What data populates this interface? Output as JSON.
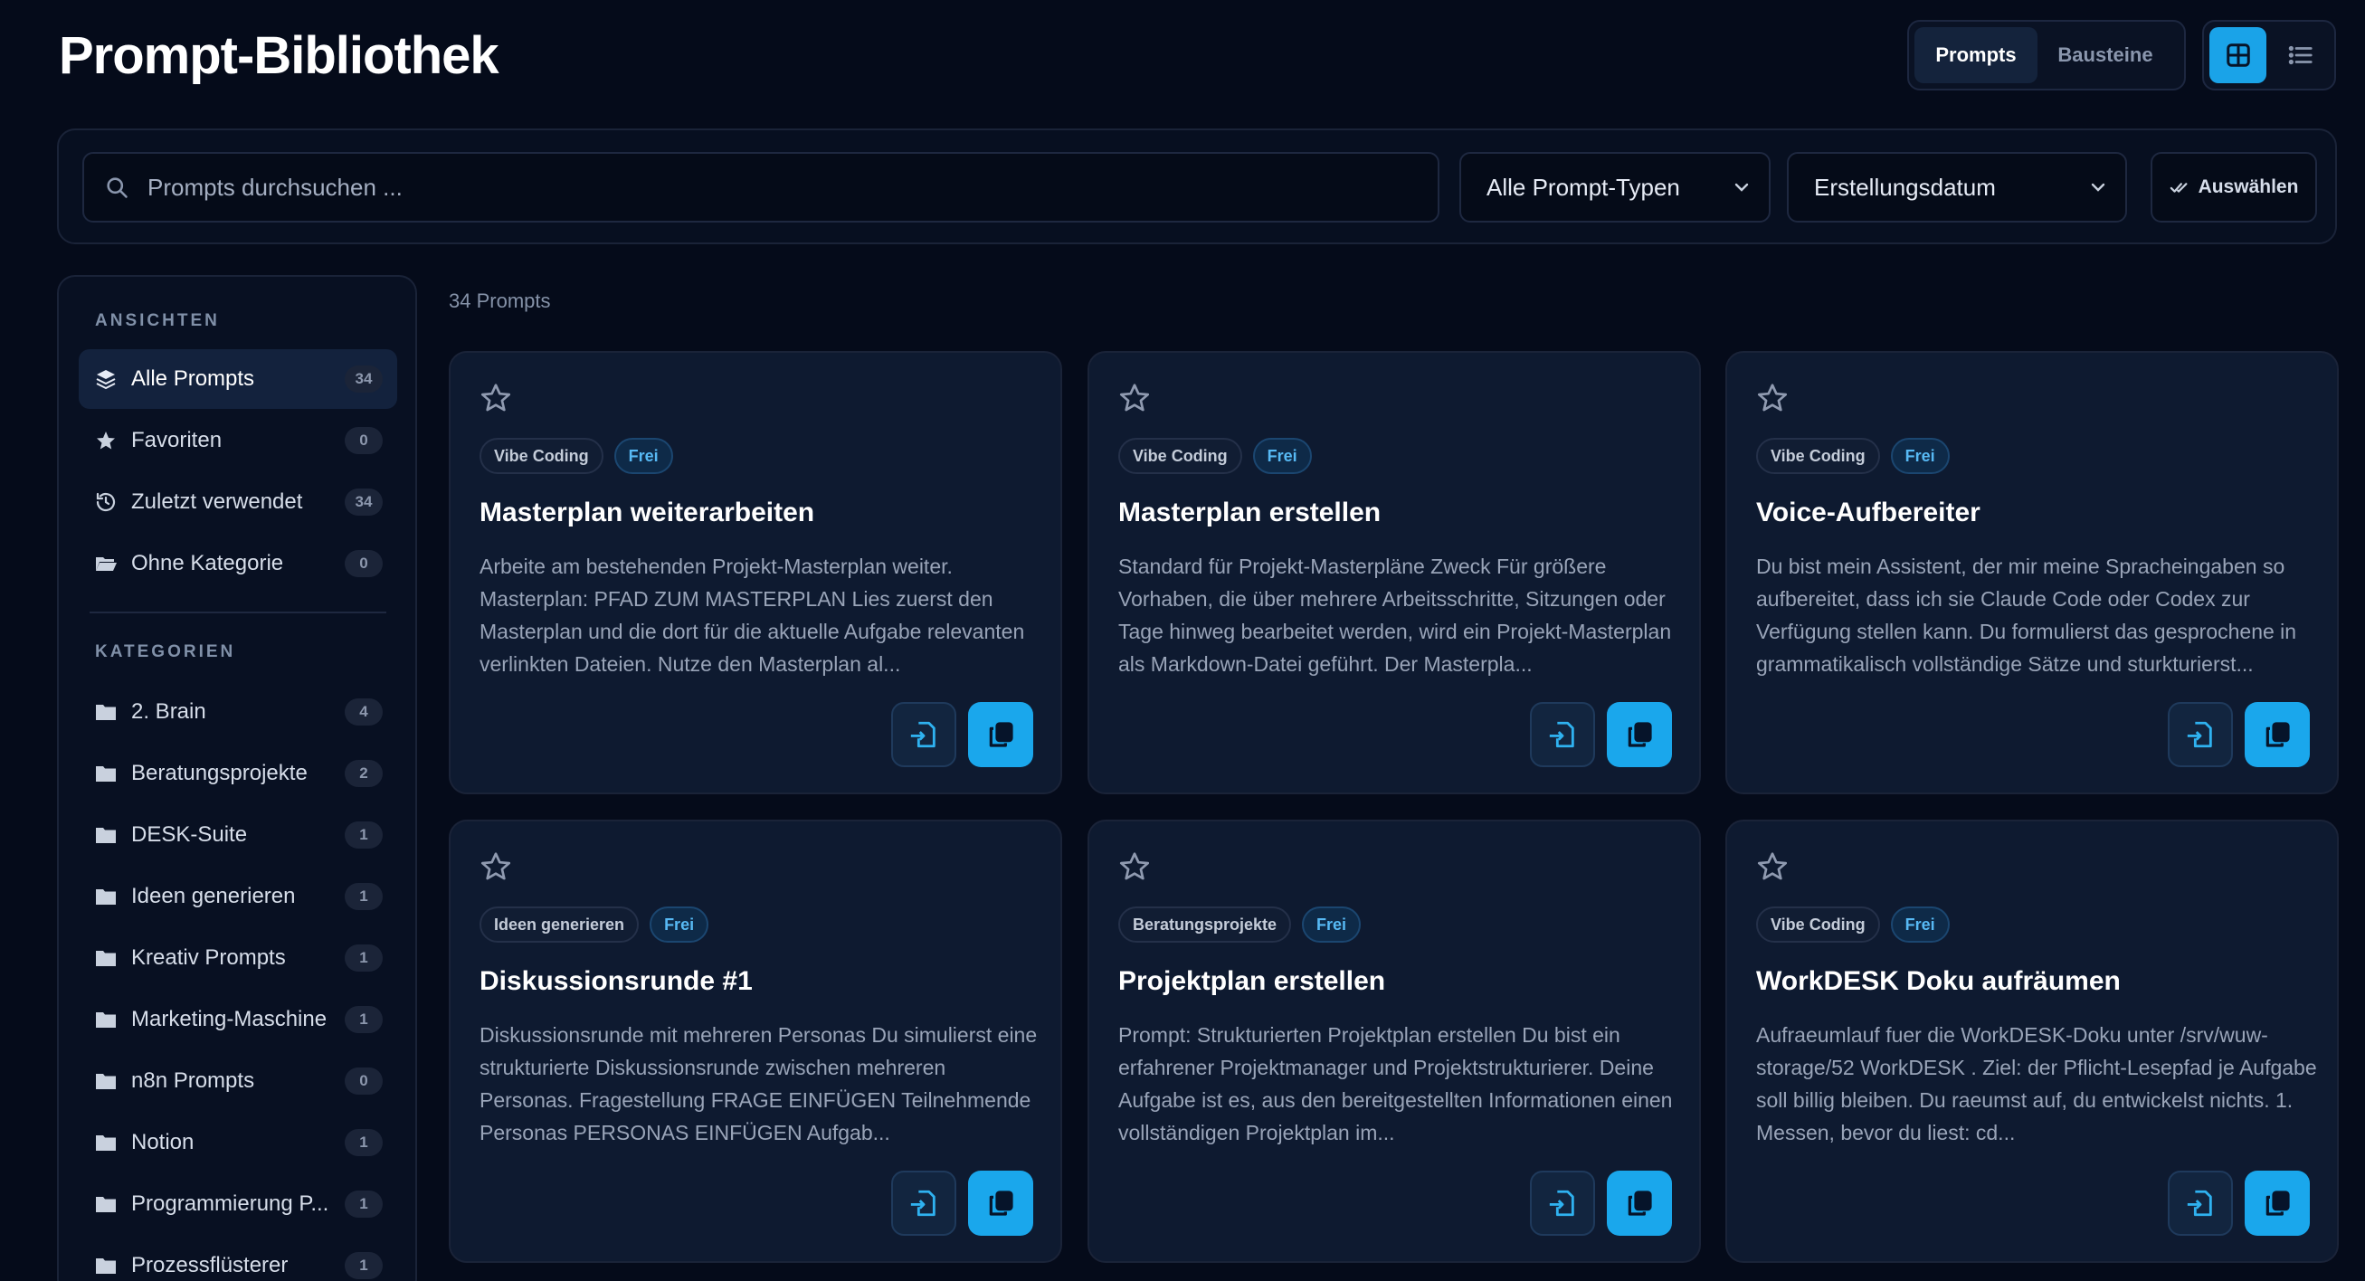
{
  "header": {
    "title": "Prompt-Bibliothek",
    "modes": [
      "Prompts",
      "Bausteine"
    ],
    "active_mode": "Prompts",
    "views": [
      "grid-view",
      "list-view"
    ],
    "active_view": "grid-view"
  },
  "filters": {
    "search_placeholder": "Prompts durchsuchen ...",
    "type_select": "Alle Prompt-Typen",
    "sort_select": "Erstellungsdatum",
    "select_button": "Auswählen"
  },
  "sidebar": {
    "views_heading": "ANSICHTEN",
    "views": [
      {
        "label": "Alle Prompts",
        "count": "34",
        "icon": "layers-icon"
      },
      {
        "label": "Favoriten",
        "count": "0",
        "icon": "star-icon"
      },
      {
        "label": "Zuletzt verwendet",
        "count": "34",
        "icon": "history-icon"
      },
      {
        "label": "Ohne Kategorie",
        "count": "0",
        "icon": "folder-open-icon"
      }
    ],
    "categories_heading": "KATEGORIEN",
    "categories": [
      {
        "label": "2. Brain",
        "count": "4"
      },
      {
        "label": "Beratungsprojekte",
        "count": "2"
      },
      {
        "label": "DESK-Suite",
        "count": "1"
      },
      {
        "label": "Ideen generieren",
        "count": "1"
      },
      {
        "label": "Kreativ Prompts",
        "count": "1"
      },
      {
        "label": "Marketing-Maschine",
        "count": "1"
      },
      {
        "label": "n8n Prompts",
        "count": "0"
      },
      {
        "label": "Notion",
        "count": "1"
      },
      {
        "label": "Programmierung P...",
        "count": "1"
      },
      {
        "label": "Prozessflüsterer",
        "count": "1"
      }
    ]
  },
  "main": {
    "count_text": "34 Prompts",
    "cards": [
      {
        "category": "Vibe Coding",
        "tier": "Frei",
        "title": "Masterplan weiterarbeiten",
        "description": "Arbeite am bestehenden Projekt-Masterplan weiter. Masterplan: PFAD ZUM MASTERPLAN Lies zuerst den Masterplan und die dort für die aktuelle Aufgabe relevanten verlinkten Dateien. Nutze den Masterplan al..."
      },
      {
        "category": "Vibe Coding",
        "tier": "Frei",
        "title": "Masterplan erstellen",
        "description": "Standard für Projekt-Masterpläne Zweck Für größere Vorhaben, die über mehrere Arbeitsschritte, Sitzungen oder Tage hinweg bearbeitet werden, wird ein Projekt-Masterplan als Markdown-Datei geführt. Der Masterpla..."
      },
      {
        "category": "Vibe Coding",
        "tier": "Frei",
        "title": "Voice-Aufbereiter",
        "description": "Du bist mein Assistent, der mir meine Spracheingaben so aufbereitet, dass ich sie Claude Code oder Codex zur Verfügung stellen kann. Du formulierst das gesprochene in grammatikalisch vollständige Sätze und sturkturierst..."
      },
      {
        "category": "Ideen generieren",
        "tier": "Frei",
        "title": "Diskussionsrunde #1",
        "description": "Diskussionsrunde mit mehreren Personas Du simulierst eine strukturierte Diskussionsrunde zwischen mehreren Personas. Fragestellung FRAGE EINFÜGEN Teilnehmende Personas PERSONAS EINFÜGEN Aufgab..."
      },
      {
        "category": "Beratungsprojekte",
        "tier": "Frei",
        "title": "Projektplan erstellen",
        "description": "Prompt: Strukturierten Projektplan erstellen Du bist ein erfahrener Projektmanager und Projektstrukturierer. Deine Aufgabe ist es, aus den bereitgestellten Informationen einen vollständigen Projektplan im..."
      },
      {
        "category": "Vibe Coding",
        "tier": "Frei",
        "title": "WorkDESK Doku aufräumen",
        "description": "Aufraeumlauf fuer die WorkDESK-Doku unter /srv/wuw-storage/52 WorkDESK . Ziel: der Pflicht-Lesepfad je Aufgabe soll billig bleiben. Du raeumst auf, du entwickelst nichts. 1. Messen, bevor du liest: cd..."
      }
    ]
  },
  "colors": {
    "background": "#050b1a",
    "accent": "#1aa7ec",
    "card": "#0e1a30"
  }
}
